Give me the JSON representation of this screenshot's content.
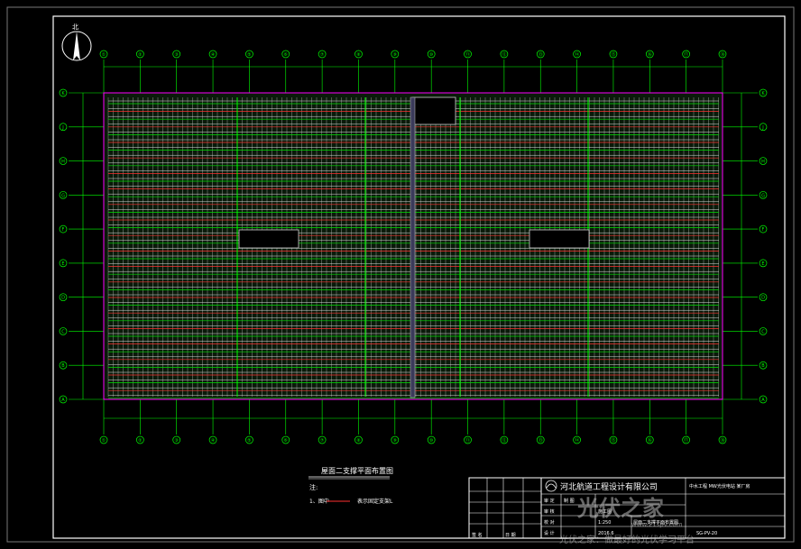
{
  "plan_title": "屋面二支撑平面布置图",
  "notes_heading": "注:",
  "note_1_prefix": "1、图中",
  "note_1_suffix": "表示固定支架L",
  "compass_label": "北",
  "axes_top": [
    "①",
    "②",
    "③",
    "④",
    "⑤",
    "⑥",
    "⑦",
    "⑧",
    "⑨",
    "⑩",
    "⑪",
    "⑫",
    "⑬",
    "⑭",
    "⑮",
    "⑯",
    "⑰",
    "⑱"
  ],
  "axes_side": [
    "K",
    "J",
    "H",
    "G",
    "F",
    "E",
    "D",
    "C",
    "B",
    "A"
  ],
  "title_block": {
    "company": "河北航道工程设计有限公司",
    "project": "中水工程 MW光伏电站 某厂房",
    "stage": "施工图",
    "drawing_name": "屋面二支撑平面布置图",
    "scale": "1:250",
    "date": "2016.6",
    "drawing_no": "SG-PV-20",
    "rows": [
      "审 定",
      "审 核",
      "校 对",
      "设 计",
      "制 图"
    ],
    "sign_labels": [
      "签 名",
      "日 期"
    ]
  },
  "watermark": {
    "brand": "光伏之家",
    "site": "www.21spv.com",
    "slogan": "光伏之家：做最好的光伏学习平台"
  },
  "colors": {
    "frame": "#ffffff",
    "grid": "#00ff00",
    "module": "#ffffff",
    "support": "#ff3030",
    "roof_edge": "#ff00ff",
    "text": "#ffffff"
  }
}
